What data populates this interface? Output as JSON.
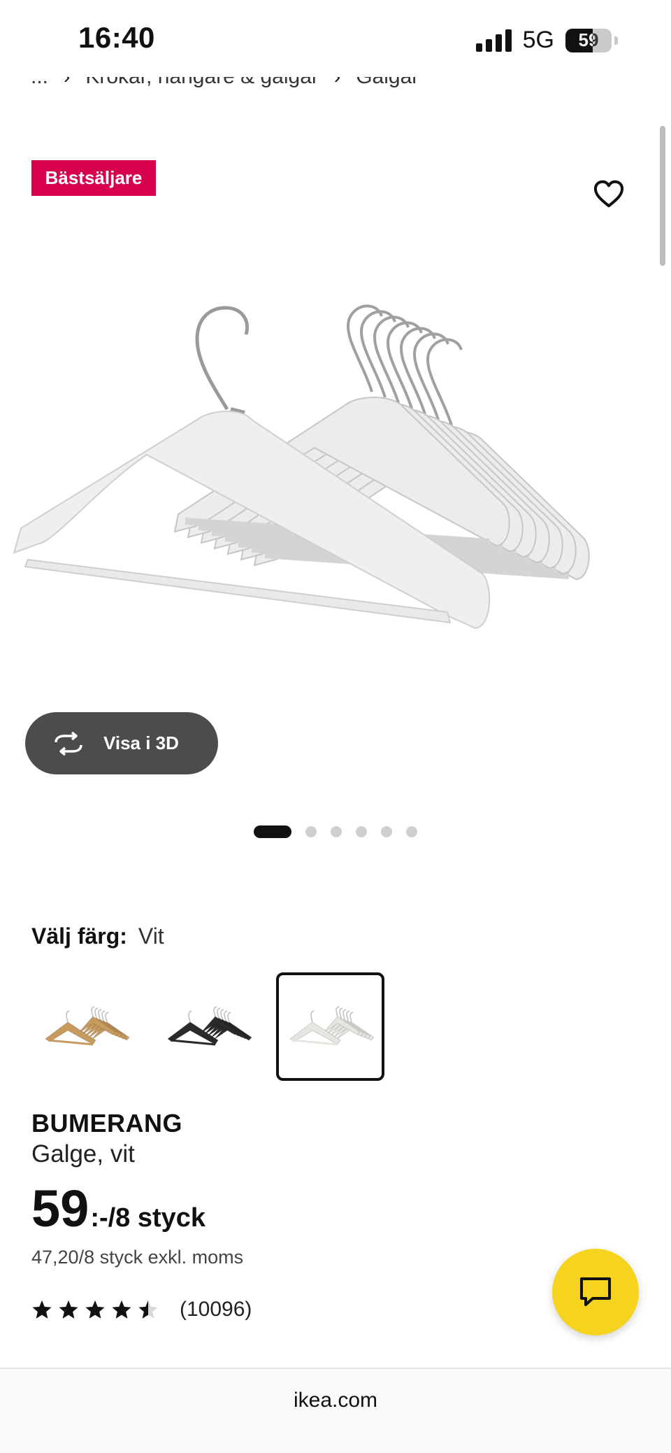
{
  "status_bar": {
    "time": "16:40",
    "network": "5G",
    "battery": "59",
    "battery_level": 0.59
  },
  "breadcrumb": {
    "items": [
      "...",
      "Krokar, hängare & galgar",
      "Galgar"
    ]
  },
  "badge": "Bästsäljare",
  "view_3d_label": "Visa i 3D",
  "carousel": {
    "total": 6,
    "active_index": 0
  },
  "color": {
    "label": "Välj färg:",
    "value": "Vit",
    "options": [
      {
        "name": "natur",
        "color": "#c79a5e"
      },
      {
        "name": "svart",
        "color": "#2a2a2a"
      },
      {
        "name": "vit",
        "color": "#e6e6e0",
        "selected": true
      }
    ]
  },
  "product": {
    "name": "BUMERANG",
    "description": "Galge, vit",
    "price": "59",
    "price_unit": ":-/8 styck",
    "price_ex_vat": "47,20/8 styck exkl. moms",
    "rating": 4.5,
    "rating_count": "(10096)"
  },
  "footer": {
    "url": "ikea.com"
  },
  "colors": {
    "badge": "#d6004f",
    "chat": "#f6d31e",
    "button_dark": "#4c4c4c"
  }
}
